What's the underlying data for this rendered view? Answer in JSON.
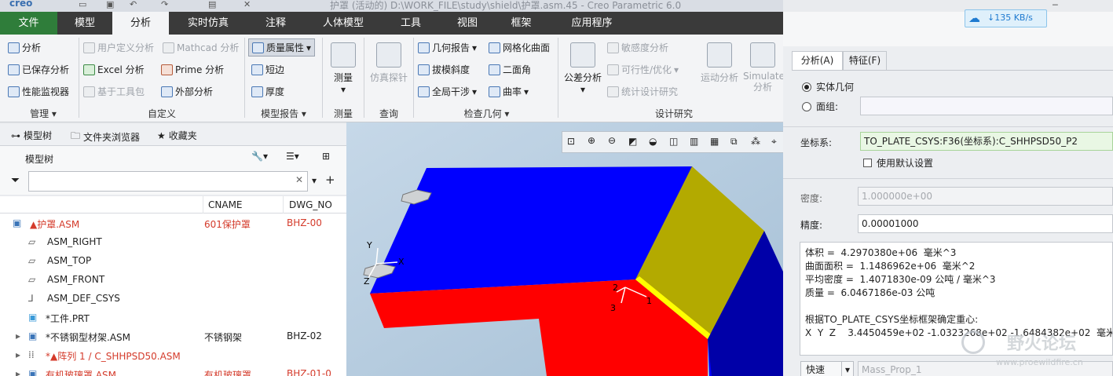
{
  "window": {
    "app": "creo",
    "title": "护罩 (活动的) D:\\WORK_FILE\\study\\shield\\护罩.asm.45 - Creo Parametric 6.0"
  },
  "tabs": [
    {
      "label": "文件"
    },
    {
      "label": "模型"
    },
    {
      "label": "分析"
    },
    {
      "label": "实时仿真"
    },
    {
      "label": "注释"
    },
    {
      "label": "人体模型"
    },
    {
      "label": "工具"
    },
    {
      "label": "视图"
    },
    {
      "label": "框架"
    },
    {
      "label": "应用程序"
    }
  ],
  "ribbon": {
    "manage": {
      "group": "管理",
      "items": [
        "分析",
        "已保存分析",
        "性能监视器"
      ]
    },
    "custom": {
      "group": "自定义",
      "items": [
        "用户定义分析",
        "Mathcad 分析",
        "Excel 分析",
        "Prime 分析",
        "基于工具包",
        "外部分析"
      ]
    },
    "model_report": {
      "group": "模型报告",
      "items": [
        "质量属性",
        "短边",
        "厚度"
      ]
    },
    "measure": {
      "group": "测量",
      "label": "测量"
    },
    "query": {
      "group": "查询",
      "label": "仿真探针"
    },
    "inspect": {
      "group": "检查几何",
      "items": [
        "几何报告",
        "网格化曲面",
        "拔模斜度",
        "二面角",
        "全局干涉",
        "曲率"
      ]
    },
    "design": {
      "group": "设计研究",
      "items": [
        "公差分析",
        "敏感度分析",
        "可行性/优化",
        "统计设计研究",
        "运动分析",
        "Simulate 分析"
      ]
    }
  },
  "left_tabs": [
    "模型树",
    "文件夹浏览器",
    "收藏夹"
  ],
  "tree": {
    "header": "模型树",
    "columns": [
      "CNAME",
      "DWG_NO"
    ],
    "rows": [
      {
        "name": "护罩.ASM",
        "cname": "601保护罩",
        "dwg": "BHZ-00",
        "red": true
      },
      {
        "name": "ASM_RIGHT",
        "cname": "",
        "dwg": "",
        "red": false
      },
      {
        "name": "ASM_TOP",
        "cname": "",
        "dwg": "",
        "red": false
      },
      {
        "name": "ASM_FRONT",
        "cname": "",
        "dwg": "",
        "red": false
      },
      {
        "name": "ASM_DEF_CSYS",
        "cname": "",
        "dwg": "",
        "red": false
      },
      {
        "name": "工件.PRT",
        "cname": "",
        "dwg": "",
        "red": false
      },
      {
        "name": "不锈钢型材架.ASM",
        "cname": "不锈钢架",
        "dwg": "BHZ-02",
        "red": false
      },
      {
        "name": "阵列 1 / C_SHHPSD50.ASM",
        "cname": "",
        "dwg": "",
        "red": true
      },
      {
        "name": "有机玻璃罩.ASM",
        "cname": "有机玻璃罩",
        "dwg": "BHZ-01-0",
        "red": true
      }
    ]
  },
  "viewport": {
    "axes": [
      "Y",
      "X",
      "Z",
      "2",
      "1",
      "3"
    ]
  },
  "panel": {
    "tabs": [
      "分析(A)",
      "特征(F)"
    ],
    "radio_solid": "实体几何",
    "radio_quilt": "面组:",
    "csys_label": "坐标系:",
    "csys_value": "TO_PLATE_CSYS:F36(坐标系):C_SHHPSD50_P2",
    "default_setting": "使用默认设置",
    "density_label": "密度:",
    "density_value": "1.000000e+00",
    "precision_label": "精度:",
    "precision_value": "0.00001000",
    "results": [
      "体积 =  4.2970380e+06  毫米^3",
      "曲面面积 =  1.1486962e+06  毫米^2",
      "平均密度 =  1.4071830e-09 公吨 / 毫米^3",
      "质量 =  6.0467186e-03 公吨",
      "",
      "根据TO_PLATE_CSYS坐标框架确定重心:",
      "X  Y  Z    3.4450459e+02 -1.0323268e+02 -1.6484382e+02  毫米"
    ],
    "quick": "快速",
    "name_value": "Mass_Prop_1"
  },
  "net_speed": "135 KB/s",
  "watermark": {
    "text": "野火论坛",
    "url": "www.proewildfire.cn"
  }
}
